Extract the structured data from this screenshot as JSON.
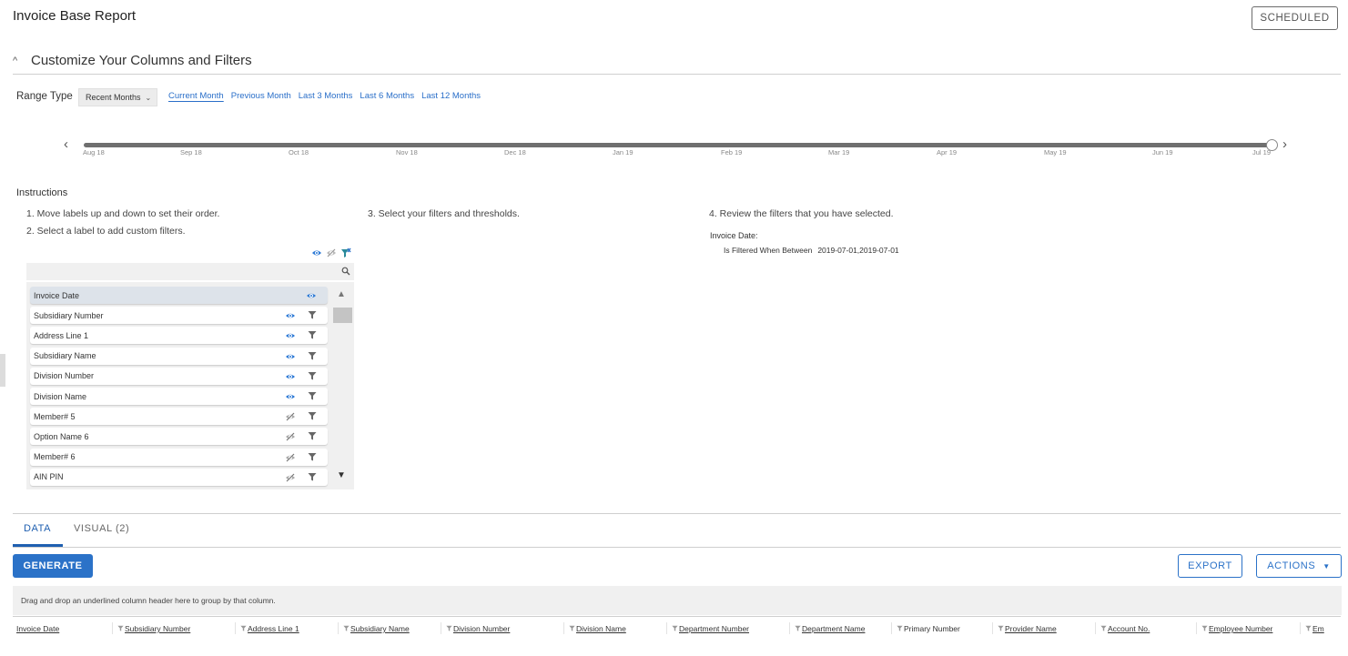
{
  "header": {
    "title": "Invoice Base Report",
    "scheduled_label": "SCHEDULED"
  },
  "customize": {
    "title": "Customize Your Columns and Filters",
    "range_type_label": "Range Type",
    "range_type_value": "Recent Months",
    "range_links": [
      "Current Month",
      "Previous Month",
      "Last 3 Months",
      "Last 6 Months",
      "Last 12 Months"
    ],
    "active_range": "Current Month",
    "timeline_ticks": [
      "Aug 18",
      "Sep 18",
      "Oct 18",
      "Nov 18",
      "Dec 18",
      "Jan 19",
      "Feb 19",
      "Mar 19",
      "Apr 19",
      "May 19",
      "Jun 19",
      "Jul 19"
    ]
  },
  "instructions": {
    "title": "Instructions",
    "step1": "1. Move labels up and down to set their order.",
    "step2": "2. Select a label to add custom filters.",
    "step3": "3. Select your filters and thresholds.",
    "step4": "4. Review the filters that you have selected.",
    "review_field": "Invoice Date:",
    "review_condition": "Is Filtered When Between",
    "review_value": "2019-07-01,2019-07-01"
  },
  "columns_list": [
    {
      "label": "Invoice Date",
      "visible": true,
      "filter": false
    },
    {
      "label": "Subsidiary Number",
      "visible": true,
      "filter": true
    },
    {
      "label": "Address Line 1",
      "visible": true,
      "filter": true
    },
    {
      "label": "Subsidiary Name",
      "visible": true,
      "filter": true
    },
    {
      "label": "Division Number",
      "visible": true,
      "filter": true
    },
    {
      "label": "Division Name",
      "visible": true,
      "filter": true
    },
    {
      "label": "Member# 5",
      "visible": false,
      "filter": true
    },
    {
      "label": "Option Name 6",
      "visible": false,
      "filter": true
    },
    {
      "label": "Member# 6",
      "visible": false,
      "filter": true
    },
    {
      "label": "AIN PIN",
      "visible": false,
      "filter": true
    }
  ],
  "tabs": [
    {
      "label": "DATA",
      "active": true
    },
    {
      "label": "VISUAL (2)",
      "active": false
    }
  ],
  "toolbar": {
    "generate_label": "GENERATE",
    "export_label": "EXPORT",
    "actions_label": "ACTIONS"
  },
  "grid": {
    "group_hint": "Drag and drop an underlined column header here to group by that column.",
    "columns": [
      {
        "label": "Invoice Date",
        "filter_icon": false,
        "underlined": true
      },
      {
        "label": "Subsidiary Number",
        "filter_icon": true,
        "underlined": true
      },
      {
        "label": "Address Line 1",
        "filter_icon": true,
        "underlined": true
      },
      {
        "label": "Subsidiary Name",
        "filter_icon": true,
        "underlined": true
      },
      {
        "label": "Division Number",
        "filter_icon": true,
        "underlined": true
      },
      {
        "label": "Division Name",
        "filter_icon": true,
        "underlined": true
      },
      {
        "label": "Department Number",
        "filter_icon": true,
        "underlined": true
      },
      {
        "label": "Department Name",
        "filter_icon": true,
        "underlined": true
      },
      {
        "label": "Primary Number",
        "filter_icon": true,
        "underlined": false
      },
      {
        "label": "Provider Name",
        "filter_icon": true,
        "underlined": true
      },
      {
        "label": "Account No.",
        "filter_icon": true,
        "underlined": true
      },
      {
        "label": "Employee Number",
        "filter_icon": true,
        "underlined": true
      },
      {
        "label": "Em",
        "filter_icon": true,
        "underlined": true
      }
    ]
  },
  "colors": {
    "accent": "#2b72c8",
    "link": "#2a6fc9",
    "eye_icon": "#2f7bd6",
    "filter_icon": "#666666"
  }
}
